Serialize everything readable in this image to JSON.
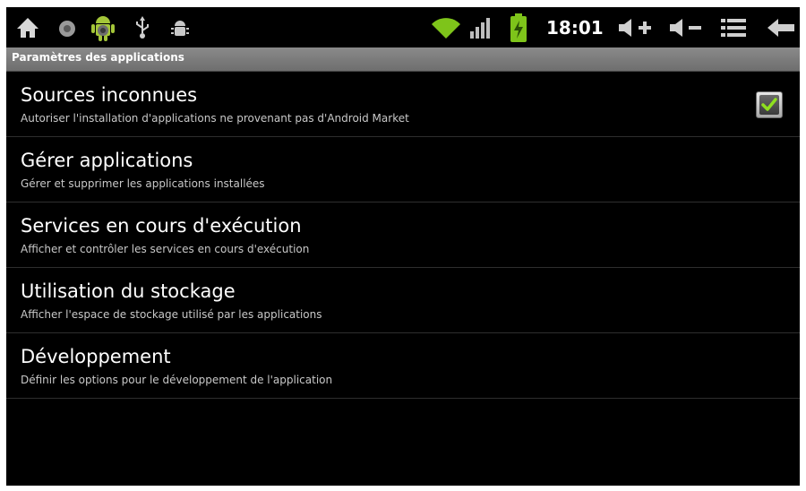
{
  "statusbar": {
    "left_icons": [
      "home-icon",
      "record-icon",
      "android-icon",
      "usb-icon",
      "debug-bug-icon"
    ],
    "right_icons": [
      "wifi-icon",
      "signal-bars-icon",
      "battery-charging-icon"
    ],
    "time": "18:01",
    "controls": [
      "volume-up-icon",
      "volume-down-icon",
      "menu-icon",
      "back-icon"
    ],
    "accent_color": "#7ec41a"
  },
  "title": "Paramètres des applications",
  "items": [
    {
      "title": "Sources inconnues",
      "summary": "Autoriser l'installation d'applications ne provenant pas d'Android Market",
      "checked": true
    },
    {
      "title": "Gérer applications",
      "summary": "Gérer et supprimer les applications installées"
    },
    {
      "title": "Services en cours d'exécution",
      "summary": "Afficher et contrôler les services en cours d'exécution"
    },
    {
      "title": "Utilisation du stockage",
      "summary": "Afficher l'espace de stockage utilisé par les applications"
    },
    {
      "title": "Développement",
      "summary": "Définir les options pour le développement de l'application"
    }
  ]
}
